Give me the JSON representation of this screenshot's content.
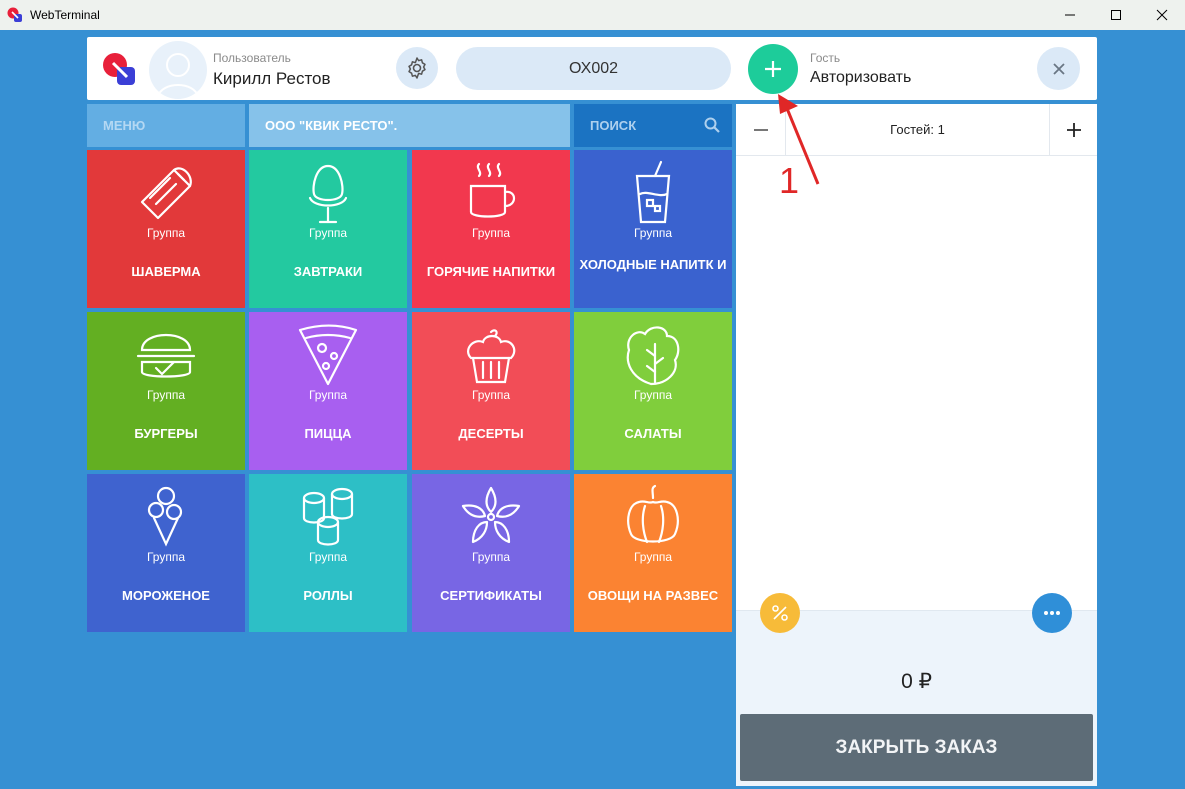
{
  "window": {
    "title": "WebTerminal"
  },
  "header": {
    "user_caption": "Пользователь",
    "user_name": "Кирилл Рестов",
    "table": "ОХ002",
    "guest_caption": "Гость",
    "guest_action": "Авторизовать"
  },
  "nav": {
    "menu": "МЕНЮ",
    "organization": "ООО \"КВИК РЕСТО\".",
    "search": "ПОИСК"
  },
  "tiles": [
    {
      "name": "ШАВЕРМА",
      "group": "Группа",
      "color": "#e2393a",
      "icon": "shawarma-icon"
    },
    {
      "name": "ЗАВТРАКИ",
      "group": "Группа",
      "color": "#23c9a0",
      "icon": "egg-icon"
    },
    {
      "name": "ГОРЯЧИЕ НАПИТКИ",
      "group": "Группа",
      "color": "#f2384e",
      "icon": "coffee-cup-icon"
    },
    {
      "name": "ХОЛОДНЫЕ НАПИТК И",
      "group": "Группа",
      "color": "#3a62cf",
      "icon": "cold-drink-icon"
    },
    {
      "name": "БУРГЕРЫ",
      "group": "Группа",
      "color": "#63af22",
      "icon": "burger-icon"
    },
    {
      "name": "ПИЦЦА",
      "group": "Группа",
      "color": "#a85ff0",
      "icon": "pizza-icon"
    },
    {
      "name": "ДЕСЕРТЫ",
      "group": "Группа",
      "color": "#f24d57",
      "icon": "cupcake-icon"
    },
    {
      "name": "САЛАТЫ",
      "group": "Группа",
      "color": "#80ce3c",
      "icon": "lettuce-icon"
    },
    {
      "name": "МОРОЖЕНОЕ",
      "group": "Группа",
      "color": "#3f63cf",
      "icon": "ice-cream-icon"
    },
    {
      "name": "РОЛЛЫ",
      "group": "Группа",
      "color": "#2dbfc6",
      "icon": "rolls-icon"
    },
    {
      "name": "СЕРТИФИКАТЫ",
      "group": "Группа",
      "color": "#7866e4",
      "icon": "flower-icon"
    },
    {
      "name": "ОВОЩИ НА РАЗВЕС",
      "group": "Группа",
      "color": "#fb8332",
      "icon": "pepper-icon"
    }
  ],
  "order": {
    "guests": "Гостей: 1",
    "total": "0 ₽",
    "close_button": "ЗАКРЫТЬ ЗАКАЗ"
  },
  "annotation": {
    "label": "1",
    "color": "#e02727"
  },
  "colors": {
    "background": "#3690d3",
    "accent_green": "#1dcc9a",
    "discount": "#f7bb39",
    "more": "#2f8fd8"
  }
}
